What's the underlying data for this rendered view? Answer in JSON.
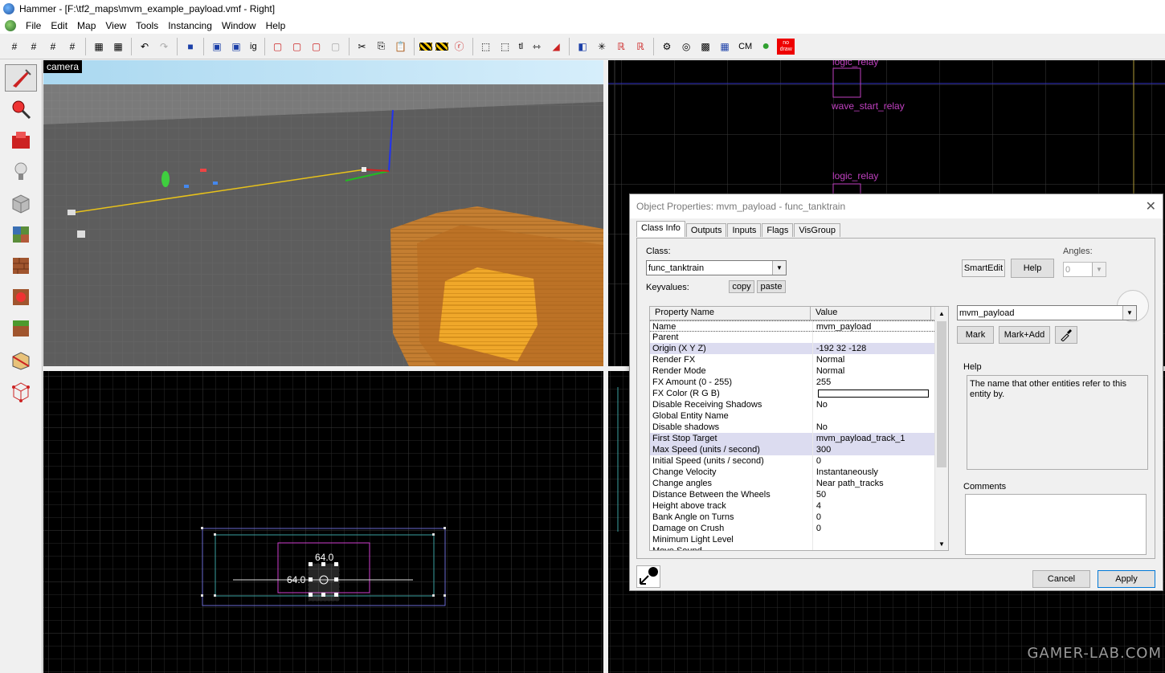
{
  "window": {
    "title": "Hammer - [F:\\tf2_maps\\mvm_example_payload.vmf - Right]"
  },
  "menu": [
    "File",
    "Edit",
    "Map",
    "View",
    "Tools",
    "Instancing",
    "Window",
    "Help"
  ],
  "toolbar": {
    "ig_label": "ig",
    "cm_label": "CM",
    "nodraw_label": "no draw"
  },
  "camera_label": "camera",
  "top_right_view": {
    "labels": [
      "logic_relay",
      "wave_start_relay",
      "logic_relay"
    ]
  },
  "bottom_left_view": {
    "dim_top": "64.0",
    "dim_left": "64.0"
  },
  "watermark": "GAMER-LAB.COM",
  "dialog": {
    "title": "Object Properties: mvm_payload - func_tanktrain",
    "tabs": [
      "Class Info",
      "Outputs",
      "Inputs",
      "Flags",
      "VisGroup"
    ],
    "class_label": "Class:",
    "class_value": "func_tanktrain",
    "keyvalues_label": "Keyvalues:",
    "copy": "copy",
    "paste": "paste",
    "smartedit": "SmartEdit",
    "help_button": "Help",
    "angles_label": "Angles:",
    "angles_value": "0",
    "columns": [
      "Property Name",
      "Value"
    ],
    "properties": [
      {
        "k": "Name",
        "v": "mvm_payload"
      },
      {
        "k": "Parent",
        "v": ""
      },
      {
        "k": "Origin (X Y Z)",
        "v": "-192 32 -128"
      },
      {
        "k": "Render FX",
        "v": "Normal"
      },
      {
        "k": "Render Mode",
        "v": "Normal"
      },
      {
        "k": "FX Amount (0 - 255)",
        "v": "255"
      },
      {
        "k": "FX Color (R G B)",
        "v": ""
      },
      {
        "k": "Disable Receiving Shadows",
        "v": "No"
      },
      {
        "k": "Global Entity Name",
        "v": ""
      },
      {
        "k": "Disable shadows",
        "v": "No"
      },
      {
        "k": "First Stop Target",
        "v": "mvm_payload_track_1"
      },
      {
        "k": "Max Speed (units / second)",
        "v": "300"
      },
      {
        "k": "Initial Speed (units / second)",
        "v": "0"
      },
      {
        "k": "Change Velocity",
        "v": "Instantaneously"
      },
      {
        "k": "Change angles",
        "v": "Near path_tracks"
      },
      {
        "k": "Distance Between the Wheels",
        "v": "50"
      },
      {
        "k": "Height above track",
        "v": "4"
      },
      {
        "k": "Bank Angle on Turns",
        "v": "0"
      },
      {
        "k": "Damage on Crush",
        "v": "0"
      },
      {
        "k": "Minimum Light Level",
        "v": ""
      },
      {
        "k": "Move Sound",
        "v": ""
      }
    ],
    "value_edit": "mvm_payload",
    "mark": "Mark",
    "mark_add": "Mark+Add",
    "help_label": "Help",
    "help_text": "The name that other entities refer to this entity by.",
    "comments_label": "Comments",
    "cancel": "Cancel",
    "apply": "Apply"
  }
}
